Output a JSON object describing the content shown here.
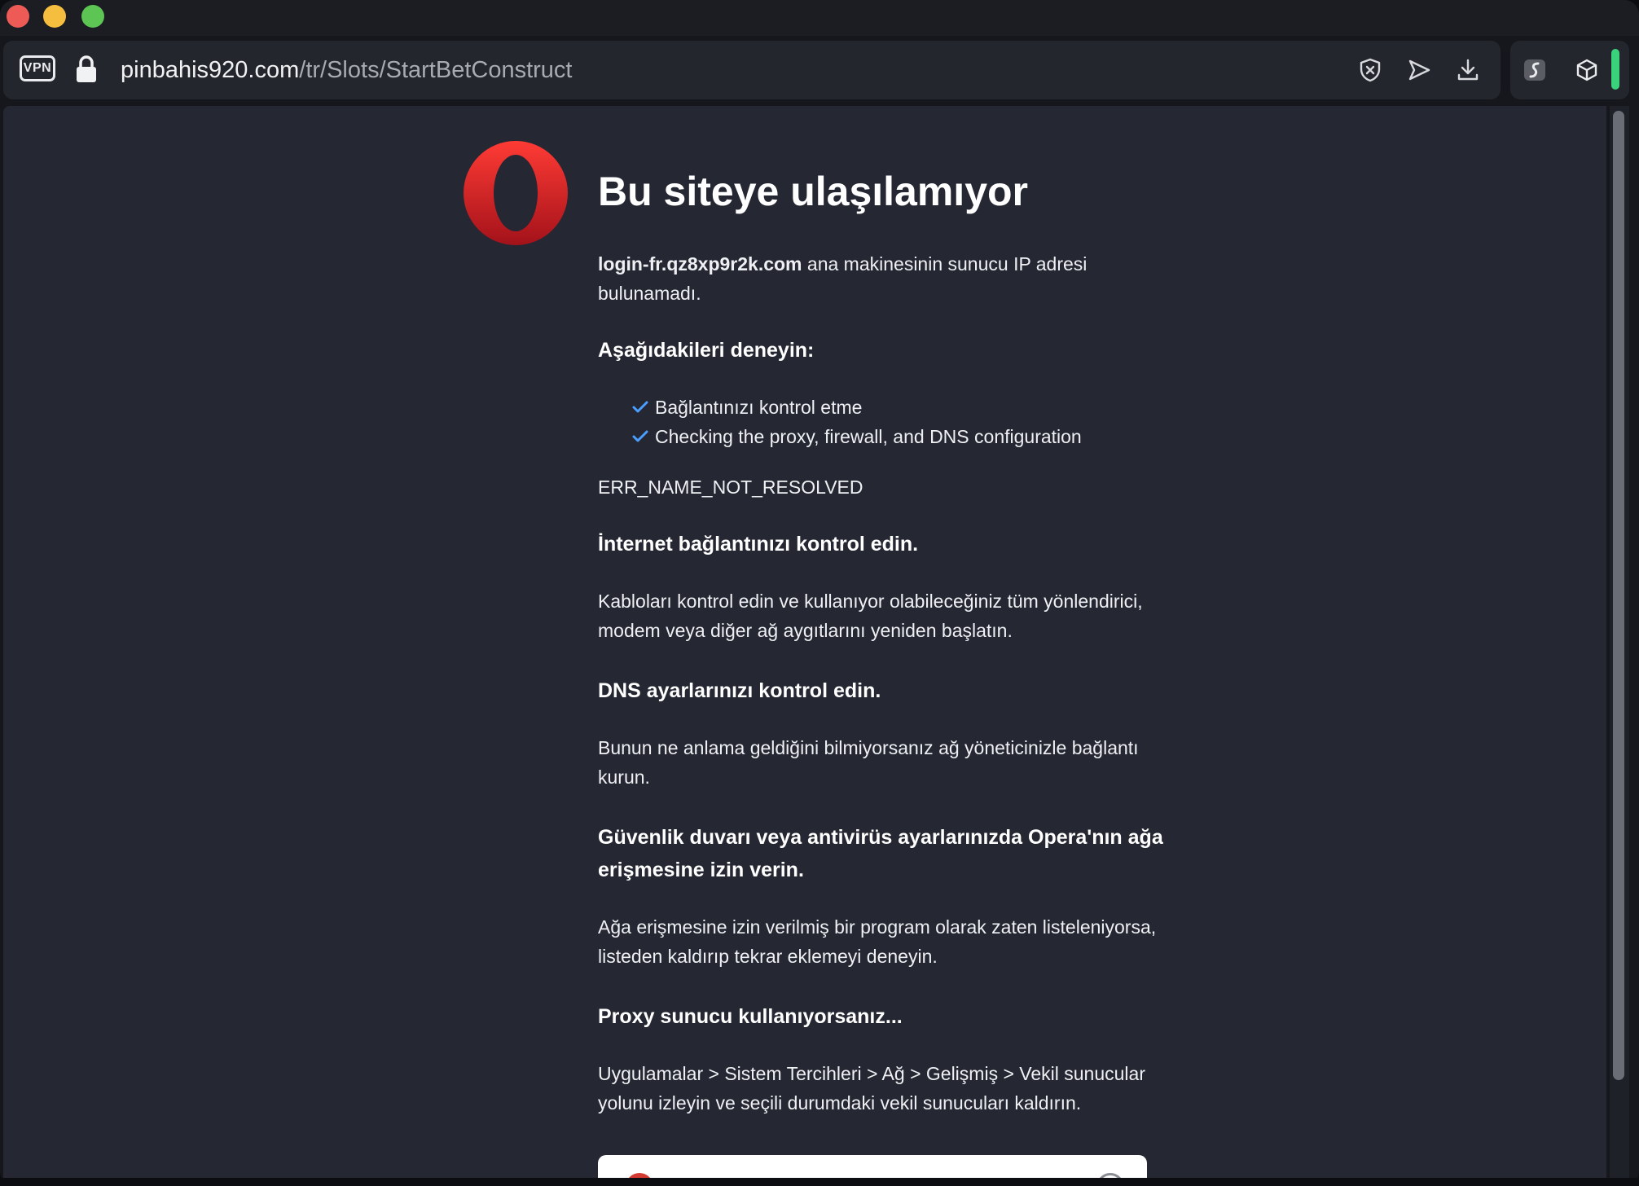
{
  "browser": {
    "vpn_label": "VPN",
    "url_host": "pinbahis920.com",
    "url_path": "/tr/Slots/StartBetConstruct",
    "address_icons": [
      "shield-x-icon",
      "send-icon",
      "download-icon"
    ],
    "tool_icons": [
      "surfshark-extension-icon",
      "cube-icon"
    ]
  },
  "error_page": {
    "title": "Bu siteye ulaşılamıyor",
    "host": "login-fr.qz8xp9r2k.com",
    "host_message": " ana makinesinin sunucu IP adresi bulunamadı.",
    "try_heading": "Aşağıdakileri deneyin:",
    "suggestions": [
      "Bağlantınızı kontrol etme",
      "Checking the proxy, firewall, and DNS configuration"
    ],
    "error_code": "ERR_NAME_NOT_RESOLVED",
    "sections": [
      {
        "heading": "İnternet bağlantınızı kontrol edin.",
        "body": "Kabloları kontrol edin ve kullanıyor olabileceğiniz tüm yönlendirici, modem veya diğer ağ aygıtlarını yeniden başlatın."
      },
      {
        "heading": "DNS ayarlarınızı kontrol edin.",
        "body": "Bunun ne anlama geldiğini bilmiyorsanız ağ yöneticinizle bağlantı kurun."
      },
      {
        "heading": "Güvenlik duvarı veya antivirüs ayarlarınızda Opera'nın ağa erişmesine izin verin.",
        "body": "Ağa erişmesine izin verilmiş bir program olarak zaten listeleniyorsa, listeden kaldırıp tekrar eklemeyi deneyin."
      },
      {
        "heading": "Proxy sunucu kullanıyorsanız...",
        "body": "Uygulamalar > Sistem Tercihleri > Ağ > Gelişmiş > Vekil sunucular yolunu izleyin ve seçili durumdaki vekil sunucuları kaldırın."
      }
    ]
  },
  "colors": {
    "page_bg": "#252733",
    "check": "#4a9fff",
    "opera_red": "#e0332d",
    "accent_green": "#3ad37c"
  }
}
